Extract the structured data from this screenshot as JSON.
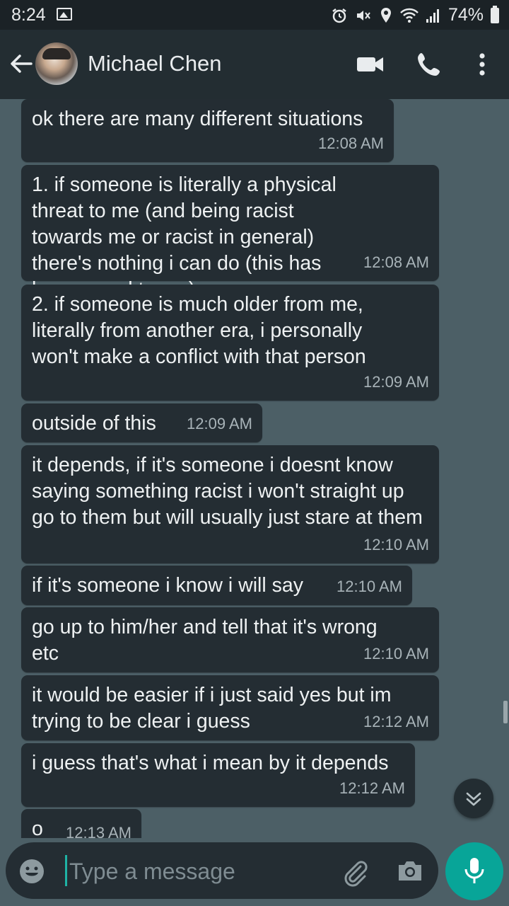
{
  "status_bar": {
    "time": "8:24",
    "battery_percent": "74%",
    "icons": [
      "gallery-icon",
      "alarm-icon",
      "mute-icon",
      "location-icon",
      "wifi-icon",
      "signal-icon",
      "battery-icon"
    ]
  },
  "header": {
    "contact_name": "Michael Chen",
    "icons": [
      "back-arrow-icon",
      "video-call-icon",
      "voice-call-icon",
      "more-options-icon"
    ]
  },
  "messages": [
    {
      "text": "ok there are many different situations",
      "time": "12:08 AM"
    },
    {
      "text": "1. if someone is literally a physical threat to me (and being racist towards me or racist in general) there's nothing i can do (this has happenned to me)",
      "time": "12:08 AM"
    },
    {
      "text": "2. if someone is much older from me, literally from another era, i personally won't make a conflict with that person",
      "time": "12:09 AM"
    },
    {
      "text": "outside of this",
      "time": "12:09 AM"
    },
    {
      "text": "it depends, if it's someone i doesnt know saying something racist i won't straight up go to them but will usually just stare at them",
      "time": "12:10 AM"
    },
    {
      "text": "if it's someone i know i will say",
      "time": "12:10 AM"
    },
    {
      "text": "go up to him/her and tell that it's wrong etc",
      "time": "12:10 AM"
    },
    {
      "text": "it would be easier if i just said yes but im trying to be clear i guess",
      "time": "12:12 AM"
    },
    {
      "text": "i guess that's what i mean by it depends",
      "time": "12:12 AM"
    },
    {
      "text": "o",
      "time": "12:13 AM"
    }
  ],
  "composer": {
    "placeholder": "Type a message",
    "icons": [
      "emoji-icon",
      "attach-icon",
      "camera-icon",
      "microphone-icon"
    ]
  },
  "colors": {
    "background": "#4c5f66",
    "header": "#232d32",
    "bubble": "#242d33",
    "accent": "#08a598"
  }
}
